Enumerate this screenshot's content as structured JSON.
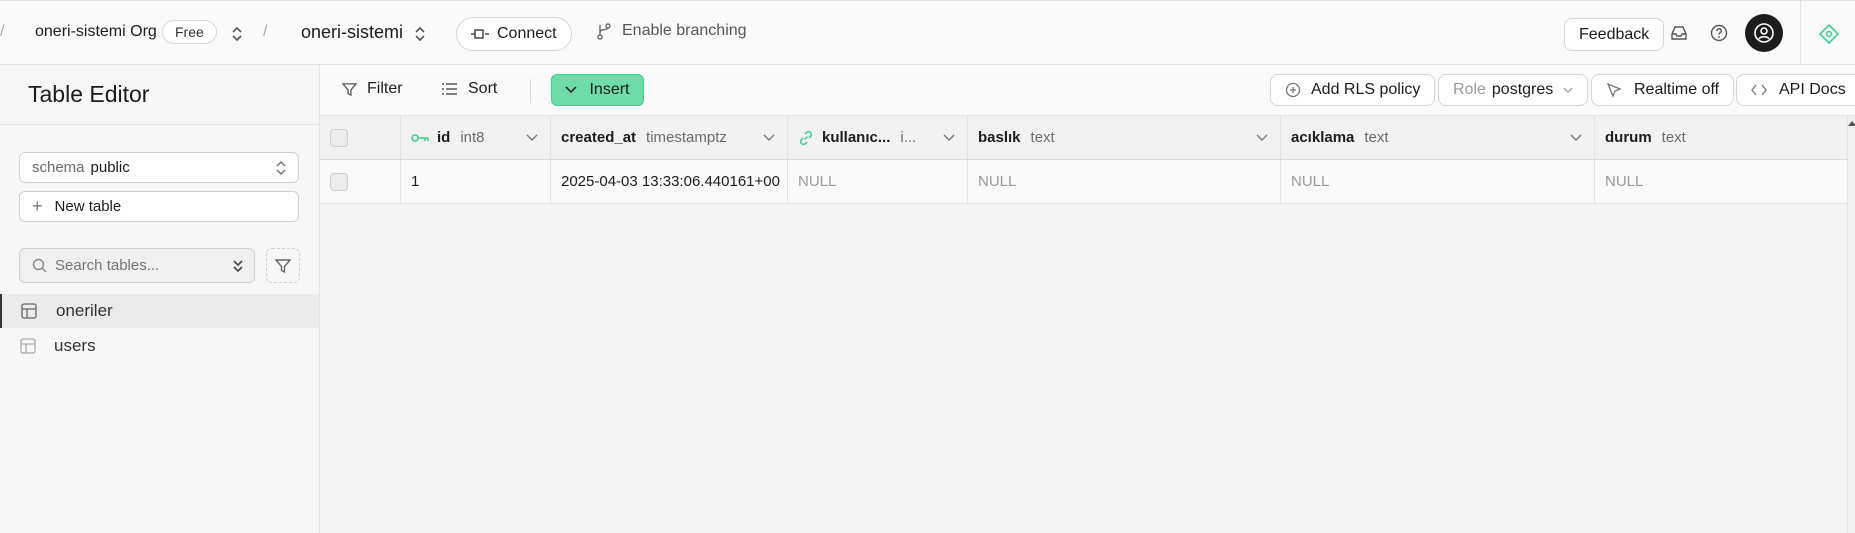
{
  "topbar": {
    "org_name": "oneri-sistemi Org",
    "plan_badge": "Free",
    "project_name": "oneri-sistemi",
    "connect_label": "Connect",
    "branching_label": "Enable branching",
    "feedback_label": "Feedback",
    "separator": "/"
  },
  "sidebar": {
    "title": "Table Editor",
    "schema_prefix": "schema",
    "schema_value": "public",
    "new_table_label": "New table",
    "search_placeholder": "Search tables...",
    "tables": [
      {
        "label": "oneriler",
        "active": true
      },
      {
        "label": "users",
        "active": false
      }
    ]
  },
  "toolbar": {
    "filter_label": "Filter",
    "sort_label": "Sort",
    "insert_label": "Insert",
    "rls_label": "Add RLS policy",
    "role_prefix": "Role",
    "role_value": "postgres",
    "realtime_label": "Realtime off",
    "api_docs_label": "API Docs"
  },
  "grid": {
    "columns": [
      {
        "name": "id",
        "type": "int8"
      },
      {
        "name": "created_at",
        "type": "timestamptz"
      },
      {
        "name": "kullanıc...",
        "type": "i..."
      },
      {
        "name": "baslık",
        "type": "text"
      },
      {
        "name": "acıklama",
        "type": "text"
      },
      {
        "name": "durum",
        "type": "text"
      }
    ],
    "rows": [
      [
        "1",
        "2025-04-03 13:33:06.440161+00",
        "NULL",
        "NULL",
        "NULL",
        "NULL"
      ]
    ]
  },
  "colors": {
    "accent": "#3ecf8e",
    "insert_bg": "#6fdca7"
  }
}
